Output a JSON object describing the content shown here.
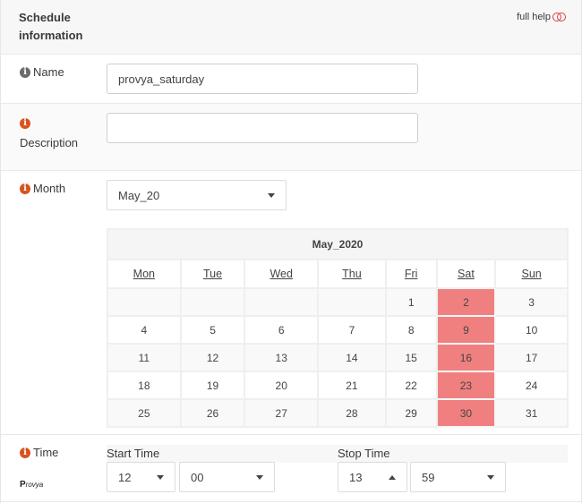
{
  "header": {
    "title_line1": "Schedule",
    "title_line2": "information",
    "full_help": "full help",
    "toggle_icon": "toggle-off-icon"
  },
  "name": {
    "label": "Name",
    "value": "provya_saturday",
    "info_icon": "info-circle-icon"
  },
  "description": {
    "label": "Description",
    "value": "",
    "info_icon": "info-circle-icon"
  },
  "month": {
    "label": "Month",
    "selected": "May_20",
    "calendar": {
      "title": "May_2020",
      "days": [
        "Mon",
        "Tue",
        "Wed",
        "Thu",
        "Fri",
        "Sat",
        "Sun"
      ],
      "weeks": [
        [
          "",
          "",
          "",
          "",
          "1",
          "2",
          "3"
        ],
        [
          "4",
          "5",
          "6",
          "7",
          "8",
          "9",
          "10"
        ],
        [
          "11",
          "12",
          "13",
          "14",
          "15",
          "16",
          "17"
        ],
        [
          "18",
          "19",
          "20",
          "21",
          "22",
          "23",
          "24"
        ],
        [
          "25",
          "26",
          "27",
          "28",
          "29",
          "30",
          "31"
        ]
      ],
      "selected_days": [
        "2",
        "9",
        "16",
        "23",
        "30"
      ],
      "selected_color": "#f08080"
    }
  },
  "time": {
    "label": "Time",
    "start_label": "Start Time",
    "stop_label": "Stop Time",
    "start_hour": "12",
    "start_minute": "00",
    "stop_hour": "13",
    "stop_minute": "59"
  },
  "logo": {
    "first": "P",
    "rest": "rovya"
  },
  "colors": {
    "info_orange": "#d9531e",
    "info_gray": "#6b6b6b",
    "toggle_red": "#e03c3c"
  }
}
